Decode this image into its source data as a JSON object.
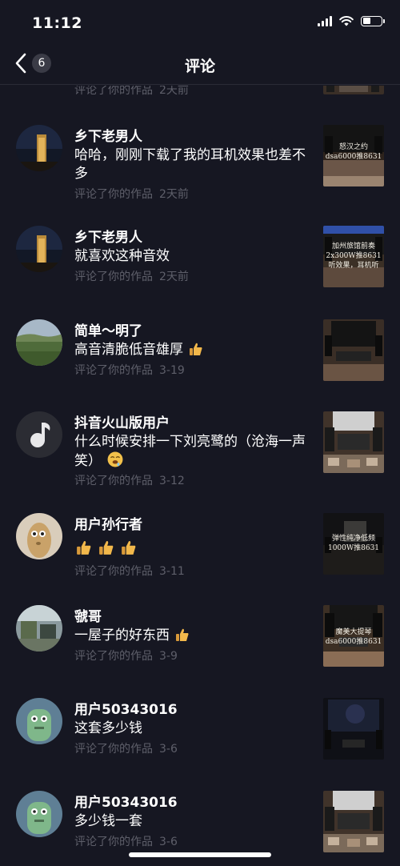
{
  "status_bar": {
    "time": "11:12"
  },
  "nav": {
    "back_count": "6",
    "title": "评论"
  },
  "partial_item": {
    "action": "评论了你的作品",
    "date": "2天前"
  },
  "items": [
    {
      "username": "乡下老男人",
      "comment": "哈哈，刚刚下载了我的耳机效果也差不多",
      "action": "评论了你的作品",
      "date": "2天前",
      "thumb_caption": "怒汉之约\ndsa6000推8631"
    },
    {
      "username": "乡下老男人",
      "comment": "就喜欢这种音效",
      "action": "评论了你的作品",
      "date": "2天前",
      "thumb_caption": "加州旅馆前奏\n2x300W推8631\n听效果，耳机听"
    },
    {
      "username": "简单～明了",
      "comment": "高音清脆低音雄厚",
      "action": "评论了你的作品",
      "date": "3-19",
      "thumb_caption": ""
    },
    {
      "username": "抖音火山版用户",
      "comment": "什么时候安排一下刘亮鹭的（沧海一声笑）",
      "action": "评论了你的作品",
      "date": "3-12",
      "thumb_caption": ""
    },
    {
      "username": "用户孙行者",
      "comment": "",
      "action": "评论了你的作品",
      "date": "3-11",
      "thumb_caption": "弹性纯净低频\n1000W推8631"
    },
    {
      "username": "虢哥",
      "comment": "一屋子的好东西",
      "action": "评论了你的作品",
      "date": "3-9",
      "thumb_caption": "魔美大提琴\ndsa6000推8631"
    },
    {
      "username": "用户50343016",
      "comment": "这套多少钱",
      "action": "评论了你的作品",
      "date": "3-6",
      "thumb_caption": ""
    },
    {
      "username": "用户50343016",
      "comment": "多少钱一套",
      "action": "评论了你的作品",
      "date": "3-6",
      "thumb_caption": ""
    }
  ],
  "icons": {
    "back": "chevron-left-icon",
    "signal": "cellular-signal-icon",
    "wifi": "wifi-icon",
    "battery": "battery-icon",
    "emoji": "thumbs-up-emoji"
  },
  "colors": {
    "background": "#161722",
    "meta_text": "#5e5f6a",
    "primary_text": "#ffffff",
    "emoji": "#f2b84b"
  }
}
